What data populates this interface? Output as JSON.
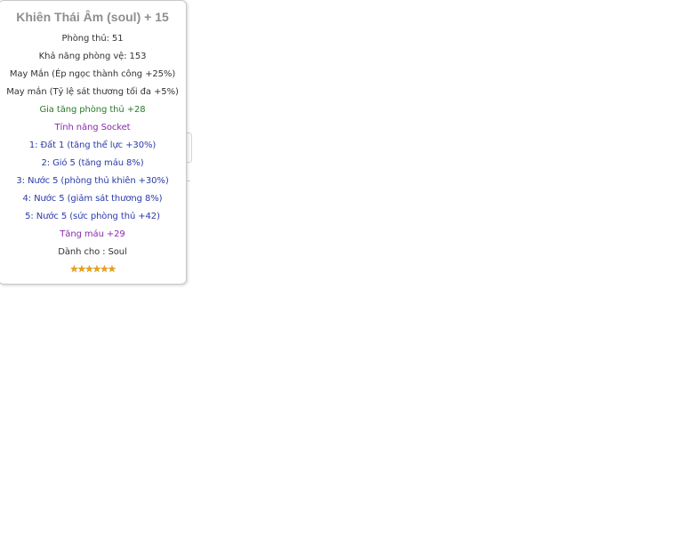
{
  "tooltip": {
    "title": "Khiên Thái Âm (soul) + 15",
    "lines": [
      {
        "text": "Phòng thủ: 51",
        "color": "#333333"
      },
      {
        "text": "Khả năng phòng vệ: 153",
        "color": "#333333"
      },
      {
        "text": "May Mắn (Ép ngọc thành công +25%)",
        "color": "#333333"
      },
      {
        "text": "May mắn (Tỷ lệ sát thương tối đa +5%)",
        "color": "#333333"
      },
      {
        "text": "Gia tăng phòng thủ +28",
        "color": "#2a7a2a"
      },
      {
        "text": "Tính năng Socket",
        "color": "#8a2ab0"
      },
      {
        "text": "1: Đất 1 (tăng thể lực +30%)",
        "color": "#2a3aa8"
      },
      {
        "text": "2: Gió 5 (tăng máu 8%)",
        "color": "#2a3aa8"
      },
      {
        "text": "3: Nước 5 (phòng thủ khiên +30%)",
        "color": "#2a3aa8"
      },
      {
        "text": "4: Nước 5 (giảm sát thương 8%)",
        "color": "#2a3aa8"
      },
      {
        "text": "5: Nước 5 (sức phòng thủ +42)",
        "color": "#2a3aa8"
      },
      {
        "text": "Tăng máu +29",
        "color": "#8a2ab0"
      },
      {
        "text": "Dành cho : Soul",
        "color": "#333333"
      }
    ],
    "rating_stars": 6,
    "star_color": "#e8a317",
    "colors": {
      "title": "#8e8e8e",
      "border": "#c9c9c9",
      "background": "#ffffff"
    }
  }
}
